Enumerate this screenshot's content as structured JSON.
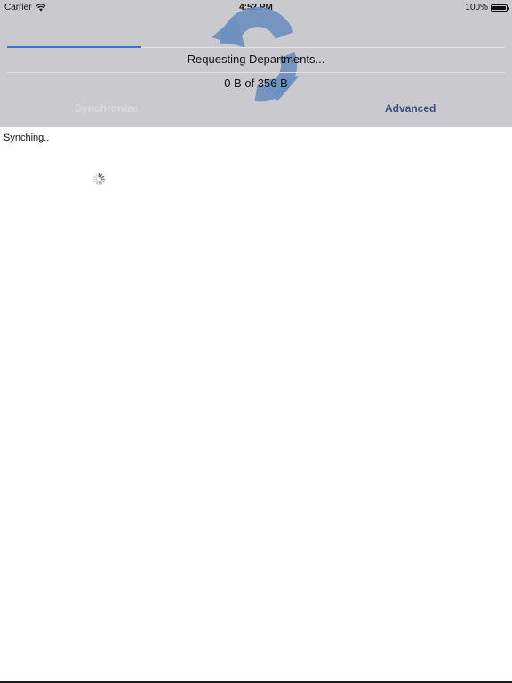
{
  "status_bar": {
    "carrier": "Carrier",
    "time": "4:52 PM",
    "battery": "100%"
  },
  "sync": {
    "message": "Requesting Departments...",
    "bytes": "0 B of 356 B",
    "progress_fraction": 0.27,
    "accent_color": "#3b6fd9"
  },
  "tabs": [
    {
      "label": "Synchronize"
    },
    {
      "label": "Advanced"
    }
  ],
  "body": {
    "status_text": "Synching.."
  },
  "icons": {
    "logo": "sync-arrows-icon",
    "spinner": "activity-spinner-icon"
  }
}
